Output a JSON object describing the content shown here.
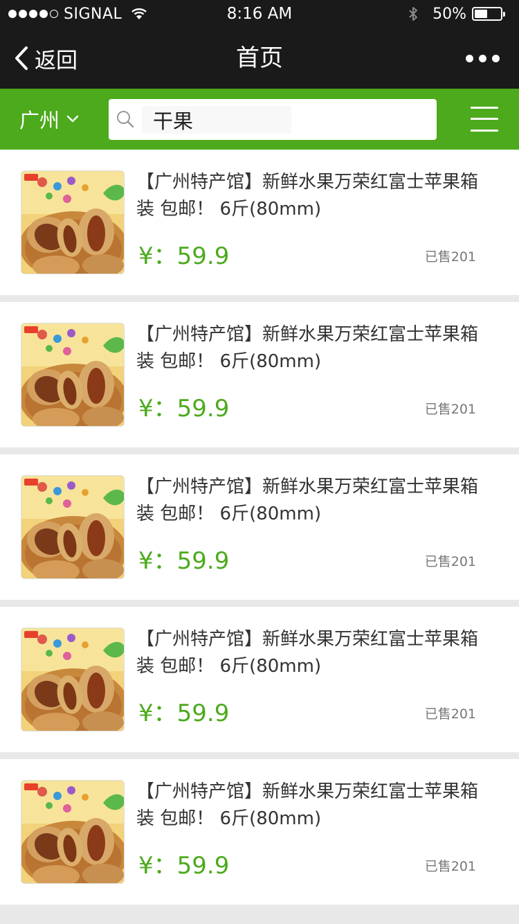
{
  "status_bar": {
    "carrier": "SIGNAL",
    "time": "8:16 AM",
    "battery_text": "50%",
    "battery_level": 0.5,
    "signal_strength": 4,
    "signal_max": 5
  },
  "nav": {
    "back_label": "返回",
    "title": "首页"
  },
  "search": {
    "city_label": "广州",
    "query_value": "干果"
  },
  "colors": {
    "accent": "#4caa1c",
    "dark_bar": "#1a1a1a",
    "background": "#e8e8e8"
  },
  "icons": {
    "back": "chevron-left-icon",
    "more": "more-dots-icon",
    "city_dropdown": "chevron-down-icon",
    "search": "search-icon",
    "menu": "hamburger-menu-icon",
    "wifi": "wifi-icon",
    "bluetooth": "bluetooth-icon",
    "battery": "battery-icon"
  },
  "products": [
    {
      "title": "【广州特产馆】新鲜水果万荣红富士苹果箱装 包邮！ 6斤(80mm)",
      "price": "¥：59.9",
      "sold": "已售201"
    },
    {
      "title": "【广州特产馆】新鲜水果万荣红富士苹果箱装 包邮！ 6斤(80mm)",
      "price": "¥：59.9",
      "sold": "已售201"
    },
    {
      "title": "【广州特产馆】新鲜水果万荣红富士苹果箱装 包邮！ 6斤(80mm)",
      "price": "¥：59.9",
      "sold": "已售201"
    },
    {
      "title": "【广州特产馆】新鲜水果万荣红富士苹果箱装 包邮！ 6斤(80mm)",
      "price": "¥：59.9",
      "sold": "已售201"
    },
    {
      "title": "【广州特产馆】新鲜水果万荣红富士苹果箱装 包邮！ 6斤(80mm)",
      "price": "¥：59.9",
      "sold": "已售201"
    }
  ]
}
